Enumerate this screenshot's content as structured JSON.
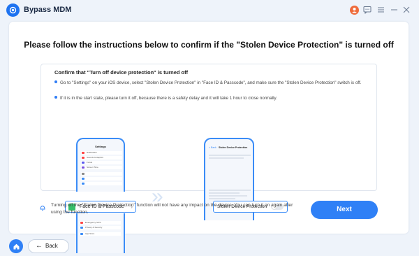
{
  "app": {
    "title": "Bypass MDM",
    "accent": "#2f80f6"
  },
  "titlebar": {
    "icons": [
      "user-icon",
      "chat-icon",
      "menu-icon",
      "minimize-icon",
      "close-icon"
    ]
  },
  "main": {
    "heading": "Please follow the instructions below to confirm if the \"Stolen Device Protection\" is turned off",
    "instructions": {
      "title": "Confirm that \"Turn off device protection\" is turned off",
      "bullets": [
        "Go to \"Settings\" on your iOS device, select \"Stolen Device Protection\" in \"Face ID & Passcode\", and make sure the \"Stolen Device Protection\" switch is off.",
        "If it is in the start state, please turn it off, because there is a safety delay and it will take 1 hour to close normally."
      ]
    },
    "illustration": {
      "phone1_title": "Settings",
      "phone1_rows": [
        "Notification",
        "Sounds & Haptics",
        "Focus",
        "Screen Time",
        "",
        "",
        "Emergency SOS",
        "Privacy & Security",
        "",
        "App Store"
      ],
      "face_id_label": "Face ID & Passcode",
      "phone2_back": "< Back",
      "phone2_title": "Stolen Device Protection",
      "stolen_device_label": "Stolen Device Protection",
      "toggle_on": false
    },
    "notice": "Turning off the \"Stolen Device Protection\" function will not have any impact on the device. You can turn it on again after using the function.",
    "next_label": "Next"
  },
  "footer": {
    "back_label": "Back"
  }
}
